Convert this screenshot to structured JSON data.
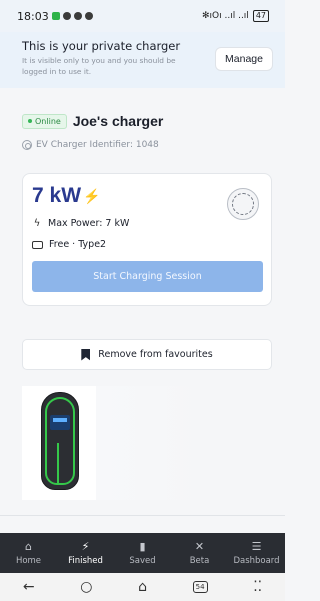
{
  "status_bar": {
    "time": "18:03",
    "right_indicators": "✻ıOı ..ıl ..ıl",
    "battery": "47"
  },
  "banner": {
    "title": "This is your private charger",
    "subtitle": "It is visible only to you and you should be logged in to use it.",
    "manage_label": "Manage"
  },
  "charger": {
    "status": "Online",
    "name": "Joe's charger",
    "identifier": "EV Charger Identifier: 1048",
    "power": "7 kW",
    "max_power": "Max Power: 7 kW",
    "price_type": "Free · Type2",
    "start_label": "Start Charging Session"
  },
  "favourites": {
    "label": "Remove from favourites"
  },
  "bottom_nav": {
    "items": [
      {
        "label": "Home",
        "icon": "home-icon"
      },
      {
        "label": "Finished",
        "icon": "bolt-icon"
      },
      {
        "label": "Saved",
        "icon": "bookmark-icon"
      },
      {
        "label": "Beta",
        "icon": "tools-icon"
      },
      {
        "label": "Dashboard",
        "icon": "menu-icon"
      }
    ],
    "active": "Finished"
  },
  "system_nav": {
    "tabs_count": "54"
  },
  "colors": {
    "accent": "#2a3a8f",
    "button": "#8db5ea",
    "online": "#2b8a43",
    "nav_bg": "#2a2d33"
  }
}
